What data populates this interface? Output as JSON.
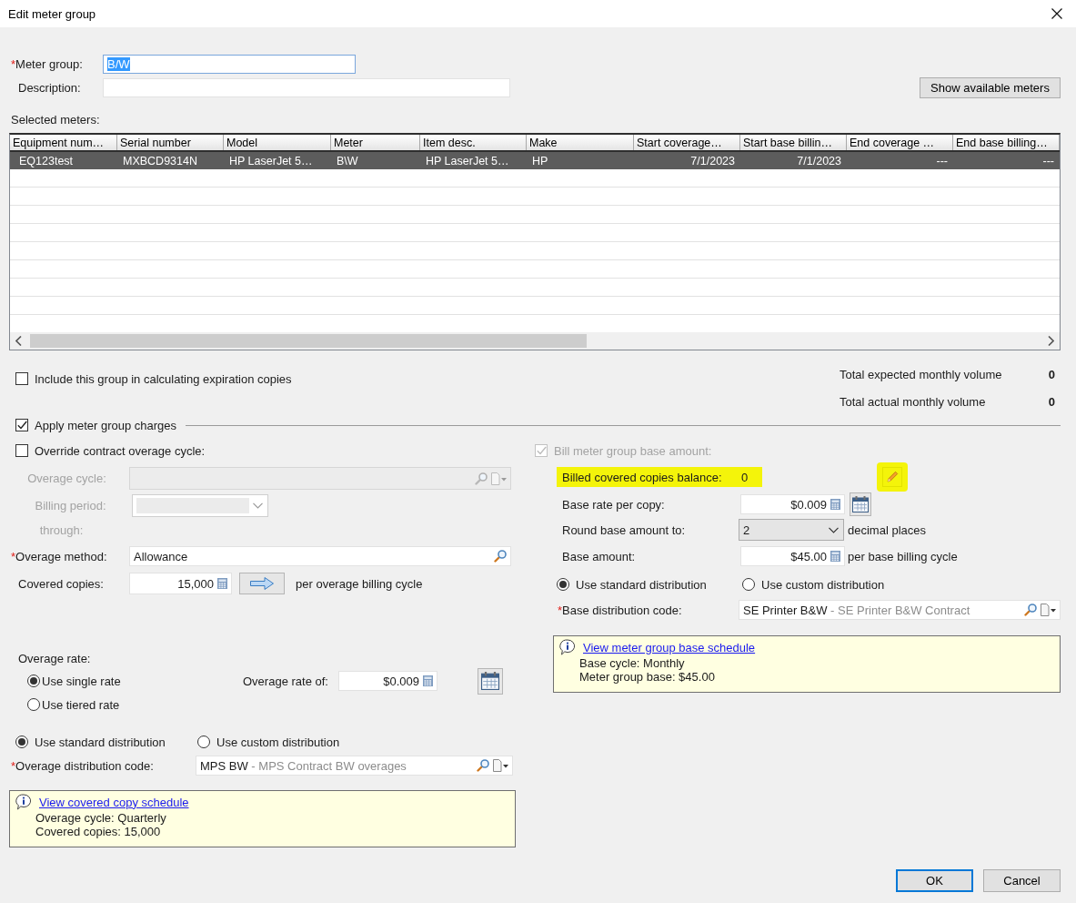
{
  "window": {
    "title": "Edit meter group"
  },
  "meter_group": {
    "required_mark": "*",
    "label": "Meter group:",
    "value": "B/W",
    "value_selected": true
  },
  "description": {
    "label": "Description:"
  },
  "show_meters_button": {
    "label": "Show available meters"
  },
  "selected_meters": {
    "label": "Selected meters:",
    "columns": [
      {
        "label": "Equipment num…",
        "kind": "text"
      },
      {
        "label": "Serial number",
        "kind": "text"
      },
      {
        "label": "Model",
        "kind": "text"
      },
      {
        "label": "Meter",
        "kind": "text"
      },
      {
        "label": "Item desc.",
        "kind": "text"
      },
      {
        "label": "Make",
        "kind": "text"
      },
      {
        "label": "Start coverage…",
        "kind": "date"
      },
      {
        "label": "Start base billin…",
        "kind": "date"
      },
      {
        "label": "End coverage …",
        "kind": "date"
      },
      {
        "label": "End base billing…",
        "kind": "date"
      }
    ],
    "rows": [
      {
        "selected": true,
        "cells": [
          "EQ123test",
          "MXBCD9314N",
          "HP LaserJet 5…",
          "B\\W",
          "HP LaserJet 5…",
          "HP",
          "7/1/2023",
          "7/1/2023",
          "---",
          "---"
        ]
      }
    ]
  },
  "include_expiration": {
    "label": "Include this group in calculating expiration copies",
    "checked": false
  },
  "totals": [
    {
      "label": "Total expected monthly volume",
      "value": "0"
    },
    {
      "label": "Total actual monthly volume",
      "value": "0"
    }
  ],
  "apply_charges": {
    "label": "Apply meter group charges",
    "checked": true
  },
  "overage": {
    "override_cycle": {
      "label": "Override contract overage cycle:",
      "checked": false
    },
    "overage_cycle": {
      "label": "Overage cycle:",
      "disabled": true
    },
    "billing_period": {
      "label": "Billing period:",
      "disabled": true
    },
    "through": {
      "label": "through:",
      "disabled": true
    },
    "overage_method": {
      "required_mark": "*",
      "label": "Overage method:",
      "value": "Allowance"
    },
    "covered_copies": {
      "label": "Covered copies:",
      "value": "15,000",
      "suffix": "per overage billing cycle"
    },
    "rate": {
      "label": "Overage rate:",
      "options": [
        {
          "label": "Use single rate",
          "selected": true
        },
        {
          "label": "Use tiered rate",
          "selected": false
        }
      ],
      "rate_label": "Overage rate of:",
      "rate_value": "$0.009"
    },
    "distribution": [
      {
        "label": "Use standard distribution",
        "selected": true
      },
      {
        "label": "Use custom distribution",
        "selected": false
      }
    ],
    "distribution_code": {
      "required_mark": "*",
      "label": "Overage distribution code:",
      "value": "MPS BW",
      "detail": "- MPS Contract BW overages"
    },
    "info": {
      "link": "View covered copy schedule",
      "lines": [
        "Overage cycle: Quarterly",
        "Covered copies: 15,000"
      ]
    }
  },
  "base": {
    "bill_base": {
      "label": "Bill meter group base amount:",
      "checked": true,
      "disabled": true
    },
    "balance": {
      "label": "Billed covered copies balance:",
      "value": "0",
      "highlighted": true
    },
    "edit": {
      "highlighted": true
    },
    "base_rate": {
      "label": "Base rate per copy:",
      "value": "$0.009"
    },
    "round": {
      "label": "Round base amount to:",
      "value": "2",
      "suffix": "decimal places"
    },
    "base_amount": {
      "label": "Base amount:",
      "value": "$45.00",
      "suffix": "per base billing cycle"
    },
    "distribution": [
      {
        "label": "Use standard distribution",
        "selected": true
      },
      {
        "label": "Use custom distribution",
        "selected": false
      }
    ],
    "distribution_code": {
      "required_mark": "*",
      "label": "Base distribution code:",
      "value": "SE Printer B&W",
      "detail": "- SE Printer B&W Contract"
    },
    "info": {
      "link": "View meter group base schedule",
      "lines": [
        "Base cycle: Monthly",
        "Meter group base: $45.00"
      ]
    }
  },
  "buttons": [
    {
      "label": "OK",
      "default": true
    },
    {
      "label": "Cancel",
      "default": false
    }
  ]
}
